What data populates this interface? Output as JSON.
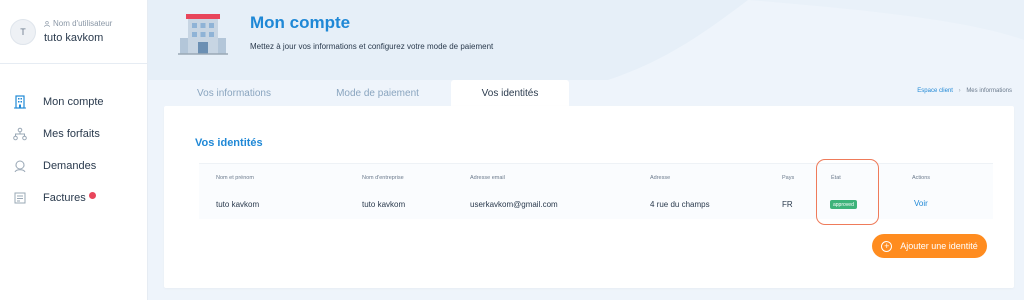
{
  "user": {
    "initial": "T",
    "label": "Nom d'utilisateur",
    "name": "tuto kavkom"
  },
  "sidebar": {
    "items": [
      {
        "label": "Mon compte",
        "icon": "building-icon"
      },
      {
        "label": "Mes forfaits",
        "icon": "sitemap-icon"
      },
      {
        "label": "Demandes",
        "icon": "support-icon"
      },
      {
        "label": "Factures",
        "icon": "invoice-icon"
      }
    ]
  },
  "header": {
    "title": "Mon compte",
    "subtitle": "Mettez à jour vos informations et configurez votre mode de paiement"
  },
  "tabs": [
    "Vos informations",
    "Mode de paiement",
    "Vos identités"
  ],
  "breadcrumb": {
    "root": "Espace client",
    "current": "Mes informations"
  },
  "section": {
    "title": "Vos identités",
    "columns": [
      "Nom et prénom",
      "Nom d'entreprise",
      "Adresse email",
      "Adresse",
      "Pays",
      "État",
      "Actions"
    ],
    "row": {
      "name": "tuto kavkom",
      "company": "tuto kavkom",
      "email": "userkavkom@gmail.com",
      "address": "4 rue du champs",
      "country": "FR",
      "status": "approved",
      "action": "Voir"
    },
    "add_button": "Ajouter une identité"
  },
  "colors": {
    "accent": "#1f88d6",
    "button": "#ff8c1f",
    "status": "#3db37a",
    "highlight": "#ef7b5a"
  }
}
